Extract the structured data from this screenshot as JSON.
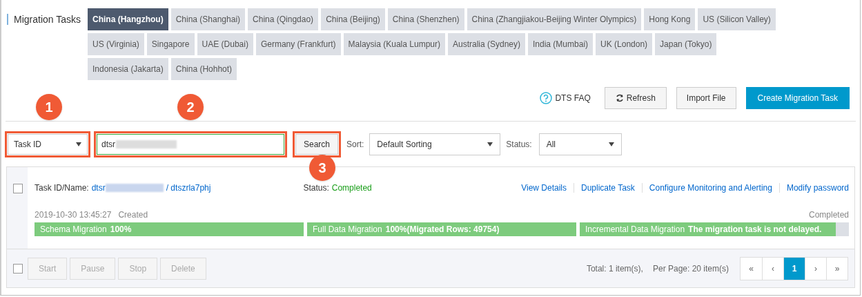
{
  "header": {
    "title": "Migration Tasks"
  },
  "region_rows": [
    {
      "tabs": [
        {
          "label": "China (Hangzhou)",
          "selected": true
        },
        {
          "label": "China (Shanghai)",
          "selected": false
        },
        {
          "label": "China (Qingdao)",
          "selected": false
        },
        {
          "label": "China (Beijing)",
          "selected": false
        },
        {
          "label": "China (Shenzhen)",
          "selected": false
        },
        {
          "label": "China (Zhangjiakou-Beijing Winter Olympics)",
          "selected": false
        },
        {
          "label": "Hong Kong",
          "selected": false
        },
        {
          "label": "US (Silicon Valley)",
          "selected": false
        }
      ]
    },
    {
      "tabs": [
        {
          "label": "US (Virginia)",
          "selected": false
        },
        {
          "label": "Singapore",
          "selected": false
        },
        {
          "label": "UAE (Dubai)",
          "selected": false
        },
        {
          "label": "Germany (Frankfurt)",
          "selected": false
        },
        {
          "label": "Malaysia (Kuala Lumpur)",
          "selected": false
        },
        {
          "label": "Australia (Sydney)",
          "selected": false
        },
        {
          "label": "India (Mumbai)",
          "selected": false
        },
        {
          "label": "UK (London)",
          "selected": false
        },
        {
          "label": "Japan (Tokyo)",
          "selected": false
        }
      ]
    },
    {
      "tabs": [
        {
          "label": "Indonesia (Jakarta)",
          "selected": false
        },
        {
          "label": "China (Hohhot)",
          "selected": false
        }
      ]
    }
  ],
  "toolbar": {
    "faq": "DTS FAQ",
    "refresh": "Refresh",
    "import": "Import File",
    "create": "Create Migration Task"
  },
  "filter": {
    "field_select": {
      "value": "Task ID",
      "callout": "1"
    },
    "search_input": {
      "value": "dtsr",
      "callout": "2"
    },
    "search_button": {
      "label": "Search",
      "callout": "3"
    },
    "sort_label": "Sort:",
    "sort_select": "Default Sorting",
    "status_label": "Status:",
    "status_select": "All"
  },
  "task": {
    "checked": false,
    "id_label": "Task ID/Name:",
    "id": "dtsr",
    "name": "/ dtszrla7phj",
    "status_label": "Status:",
    "status": "Completed",
    "actions": [
      "View Details",
      "Duplicate Task",
      "Configure Monitoring and Alerting",
      "Modify password"
    ],
    "created_time": "2019-10-30 13:45:27",
    "created_label": "Created",
    "state": "Completed",
    "stages": [
      {
        "name": "Schema Migration",
        "detail": "100%",
        "level": 1
      },
      {
        "name": "Full Data Migration",
        "detail": "100%(Migrated Rows: 49754)",
        "level": 1
      },
      {
        "name": "Incremental Data Migration",
        "detail": "The migration task is not delayed.",
        "level": 0.95
      }
    ]
  },
  "footer": {
    "select_all_checked": false,
    "buttons": [
      "Start",
      "Pause",
      "Stop",
      "Delete"
    ],
    "total": "Total: 1 item(s),",
    "per_page": "Per Page: 20 item(s)",
    "pages": [
      {
        "label": "«",
        "selected": false
      },
      {
        "label": "‹",
        "selected": false
      },
      {
        "label": "1",
        "selected": true
      },
      {
        "label": "›",
        "selected": false
      },
      {
        "label": "»",
        "selected": false
      }
    ]
  }
}
